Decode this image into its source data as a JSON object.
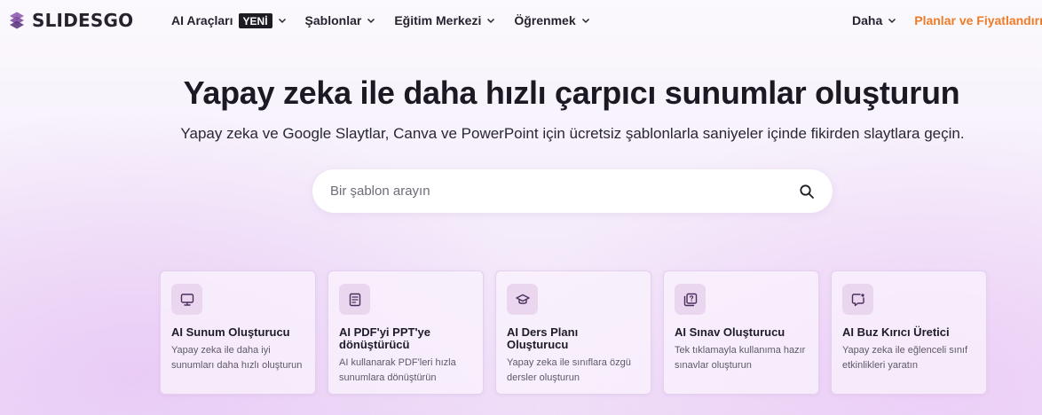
{
  "brand": {
    "name": "SLIDESGO"
  },
  "nav": {
    "items": [
      {
        "label": "AI Araçları",
        "badge": "YENİ"
      },
      {
        "label": "Şablonlar"
      },
      {
        "label": "Eğitim Merkezi"
      },
      {
        "label": "Öğrenmek"
      }
    ],
    "more_label": "Daha",
    "pricing_label": "Planlar ve Fiyatlandırma"
  },
  "hero": {
    "title": "Yapay zeka ile daha hızlı çarpıcı sunumlar oluşturun",
    "subtitle": "Yapay zeka ve Google Slaytlar, Canva ve PowerPoint için ücretsiz şablonlarla saniyeler içinde fikirden slaytlara geçin."
  },
  "search": {
    "placeholder": "Bir şablon arayın",
    "value": "",
    "icon": "search-icon"
  },
  "cards": [
    {
      "icon": "presentation-icon",
      "title": "AI Sunum Oluşturucu",
      "desc": "Yapay zeka ile daha iyi sunumları daha hızlı oluşturun"
    },
    {
      "icon": "pdf-convert-icon",
      "title": "AI PDF'yi PPT'ye dönüştürücü",
      "desc": "AI kullanarak PDF'leri hızla sunumlara dönüştürün"
    },
    {
      "icon": "graduation-cap-icon",
      "title": "AI Ders Planı Oluşturucu",
      "desc": "Yapay zeka ile sınıflara özgü dersler oluşturun"
    },
    {
      "icon": "quiz-icon",
      "title": "AI Sınav Oluşturucu",
      "desc": "Tek tıklamayla kullanıma hazır sınavlar oluşturun"
    },
    {
      "icon": "chat-icon",
      "title": "AI Buz Kırıcı Üretici",
      "desc": "Yapay zeka ile eğlenceli sınıf etkinlikleri yaratın"
    }
  ],
  "colors": {
    "accent_orange": "#ef7b26",
    "logo_purple": "#8a5aa8",
    "card_icon_bg": "#ead6ef",
    "text_dark": "#1b1923"
  }
}
